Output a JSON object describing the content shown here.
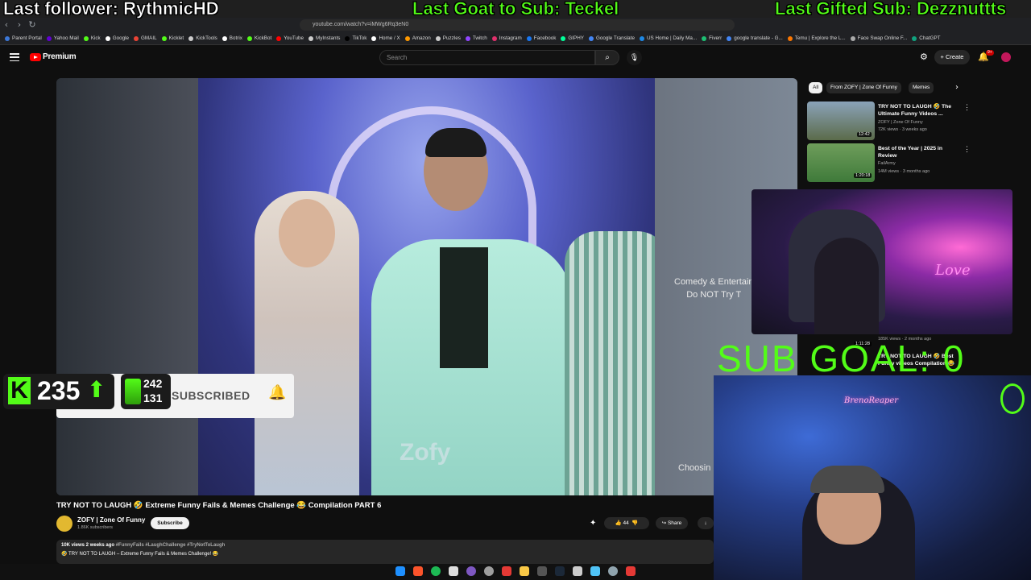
{
  "overlay": {
    "last_follower": "Last follower: RythmicHD",
    "last_goat": "Last Goat to Sub: Teckel",
    "last_gifted": "Last Gifted Sub: Dezznuttts",
    "sub_goal": "SUB GOAL: 0 /10",
    "kick_viewers": "235",
    "stat_up": "242",
    "stat_down": "131"
  },
  "browser": {
    "url": "youtube.com/watch?v=iMWg6Rq3eN0",
    "bookmarks": [
      {
        "label": "Parent Portal",
        "color": "#3c78d8"
      },
      {
        "label": "Yahoo Mail",
        "color": "#6001d2"
      },
      {
        "label": "Kick",
        "color": "#53fc18"
      },
      {
        "label": "Google",
        "color": "#ffffff"
      },
      {
        "label": "GMAIL",
        "color": "#ea4335"
      },
      {
        "label": "Kicklet",
        "color": "#53fc18"
      },
      {
        "label": "KickTools",
        "color": "#cccccc"
      },
      {
        "label": "Botrix",
        "color": "#ffffff"
      },
      {
        "label": "KickBot",
        "color": "#53fc18"
      },
      {
        "label": "YouTube",
        "color": "#ff0000"
      },
      {
        "label": "MyInstants",
        "color": "#cccccc"
      },
      {
        "label": "TikTok",
        "color": "#000000"
      },
      {
        "label": "Home / X",
        "color": "#ffffff"
      },
      {
        "label": "Amazon",
        "color": "#ff9900"
      },
      {
        "label": "Puzzles",
        "color": "#cccccc"
      },
      {
        "label": "Twitch",
        "color": "#9146ff"
      },
      {
        "label": "Instagram",
        "color": "#e1306c"
      },
      {
        "label": "Facebook",
        "color": "#1877f2"
      },
      {
        "label": "GIPHY",
        "color": "#00ff99"
      },
      {
        "label": "Google Translate",
        "color": "#4285f4"
      },
      {
        "label": "US Home | Daily Ma...",
        "color": "#1e88e5"
      },
      {
        "label": "Fiverr",
        "color": "#1dbf73"
      },
      {
        "label": "google translate - G...",
        "color": "#4285f4"
      },
      {
        "label": "Temu | Explore the L...",
        "color": "#fb7701"
      },
      {
        "label": "Face Swap Online F...",
        "color": "#aaaaaa"
      },
      {
        "label": "ChatGPT",
        "color": "#10a37f"
      }
    ]
  },
  "youtube": {
    "brand": "Premium",
    "search_placeholder": "Search",
    "create_label": "Create",
    "notif_count": "9+",
    "video": {
      "title": "TRY NOT TO LAUGH 🤣 Extreme Funny Fails & Memes Challenge 😂 Compilation PART 6",
      "channel": "ZOFY | Zone Of Funny",
      "subscribers": "1.86K subscribers",
      "subscribe_label": "Subscribe",
      "likes": "44",
      "share_label": "Share",
      "meta": "10K views  2 weeks ago",
      "tags": "#FunnyFails #LaughChallenge #TryNotToLaugh",
      "desc_line": "🤣 TRY NOT TO LAUGH – Extreme Funny Fails & Memes Challenge! 😂",
      "watermark": "Zofy",
      "side_caption_1": "Comedy & Entertain",
      "side_caption_2": "Do NOT Try T",
      "side_choosing": "Choosin",
      "subscribed_overlay": "SUBSCRIBED"
    },
    "chips": [
      "All",
      "From ZOFY | Zone Of Funny",
      "Memes"
    ],
    "recommendations": [
      {
        "title": "TRY NOT TO LAUGH 🤣 The Ultimate Funny Videos ...",
        "channel": "ZOFY | Zone Of Funny",
        "meta": "72K views · 3 weeks ago",
        "duration": "12:42",
        "thumb": "#5b6b4a"
      },
      {
        "title": "Best of the Year | 2025 in Review",
        "channel": "FailArmy",
        "meta": "14M views · 3 months ago",
        "duration": "1:20:18",
        "thumb": "#3f7a3a"
      }
    ],
    "extra_rec": {
      "title": "TRY NOT TO LAUGH 🤣 Best Funny videos Compilation 😂",
      "duration": "1:11:28",
      "meta": "185K views · 2 months ago"
    }
  },
  "cam": {
    "neon_1": "Love",
    "neon_2": "BrenoReaper"
  },
  "colors": {
    "kick_green": "#53fc18",
    "youtube_red": "#ff0000",
    "overlay_white": "#ffffff"
  }
}
